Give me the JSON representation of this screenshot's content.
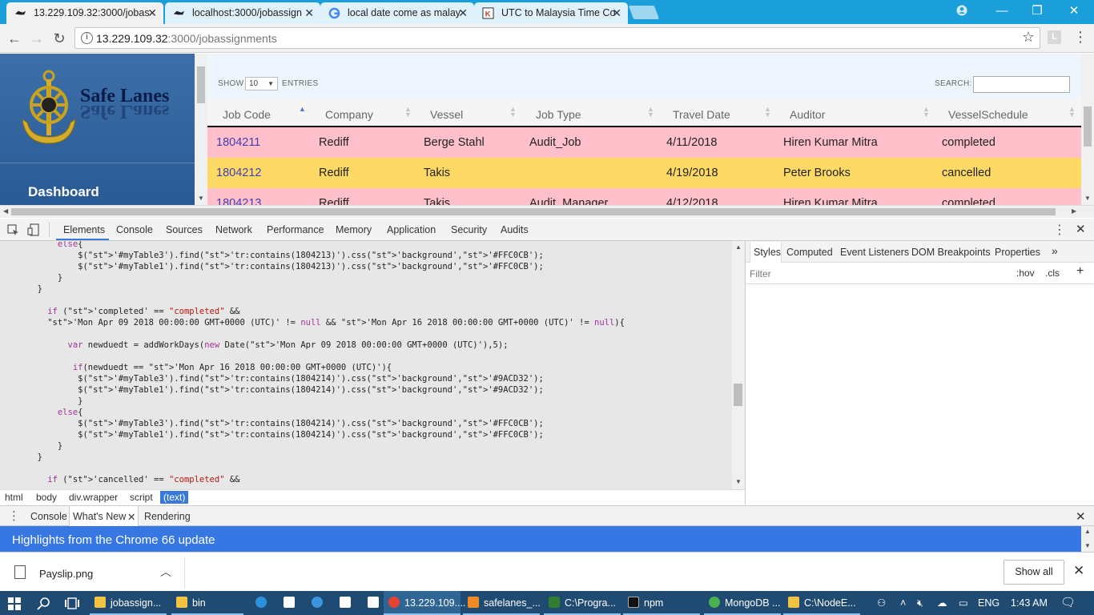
{
  "browser": {
    "tabs": [
      {
        "title": "13.229.109.32:3000/jobas"
      },
      {
        "title": "localhost:3000/jobassign"
      },
      {
        "title": "local date come as malay"
      },
      {
        "title": "UTC to Malaysia Time Co"
      }
    ],
    "url_host": "13.229.109.32",
    "url_path": ":3000/jobassignments",
    "profile_letter": "L"
  },
  "sidebar": {
    "brand": "Safe Lanes",
    "nav_dashboard": "Dashboard"
  },
  "table_controls": {
    "show_label": "SHOW",
    "entries_value": "10",
    "entries_label": "ENTRIES",
    "search_label": "SEARCH:"
  },
  "table": {
    "columns": [
      "Job Code",
      "Company",
      "Vessel",
      "Job Type",
      "Travel Date",
      "Auditor",
      "VesselSchedule"
    ],
    "rows": [
      {
        "code": "1804211",
        "company": "Rediff",
        "vessel": "Berge Stahl",
        "job_type": "Audit_Job",
        "date": "4/11/2018",
        "auditor": "Hiren Kumar Mitra",
        "schedule": "completed",
        "color": "#FFC0CB"
      },
      {
        "code": "1804212",
        "company": "Rediff",
        "vessel": "Takis",
        "job_type": "",
        "date": "4/19/2018",
        "auditor": "Peter Brooks",
        "schedule": "cancelled",
        "color": "#FFD966"
      },
      {
        "code": "1804213",
        "company": "Rediff",
        "vessel": "Takis",
        "job_type": "Audit_Manager",
        "date": "4/12/2018",
        "auditor": "Hiren Kumar Mitra",
        "schedule": "completed",
        "color": "#FFC0CB"
      }
    ]
  },
  "devtools": {
    "tabs": [
      "Elements",
      "Console",
      "Sources",
      "Network",
      "Performance",
      "Memory",
      "Application",
      "Security",
      "Audits"
    ],
    "code_lines": [
      "            else{",
      "                $('#myTable3').find('tr:contains(1804213)').css('background','#FFC0CB');",
      "                $('#myTable1').find('tr:contains(1804213)').css('background','#FFC0CB');",
      "            }",
      "        }",
      "",
      "          if ('completed' == \"completed\" &&",
      "          'Mon Apr 09 2018 00:00:00 GMT+0000 (UTC)' != null && 'Mon Apr 16 2018 00:00:00 GMT+0000 (UTC)' != null){",
      "",
      "              var newduedt = addWorkDays(new Date('Mon Apr 09 2018 00:00:00 GMT+0000 (UTC)'),5);",
      "",
      "               if(newduedt == 'Mon Apr 16 2018 00:00:00 GMT+0000 (UTC)'){",
      "                $('#myTable3').find('tr:contains(1804214)').css('background','#9ACD32');",
      "                $('#myTable1').find('tr:contains(1804214)').css('background','#9ACD32');",
      "                }",
      "            else{",
      "                $('#myTable3').find('tr:contains(1804214)').css('background','#FFC0CB');",
      "                $('#myTable1').find('tr:contains(1804214)').css('background','#FFC0CB');",
      "            }",
      "        }",
      "",
      "          if ('cancelled' == \"completed\" &&"
    ],
    "breadcrumbs": [
      "html",
      "body",
      "div.wrapper",
      "script",
      "(text)"
    ],
    "style_tabs": [
      "Styles",
      "Computed",
      "Event Listeners",
      "DOM Breakpoints",
      "Properties"
    ],
    "filter_placeholder": "Filter",
    "hov": ":hov",
    "cls": ".cls",
    "drawer_tabs": [
      "Console",
      "What's New",
      "Rendering"
    ],
    "banner": "Highlights from the Chrome 66 update"
  },
  "downloads": {
    "file": "Payslip.png",
    "show_all": "Show all"
  },
  "taskbar": {
    "items": [
      "jobassign...",
      "bin",
      "13.229.109....",
      "safelanes_...",
      "C:\\Progra...",
      "npm",
      "MongoDB ...",
      "C:\\NodeE..."
    ],
    "lang": "ENG",
    "time": "1:43 AM"
  }
}
